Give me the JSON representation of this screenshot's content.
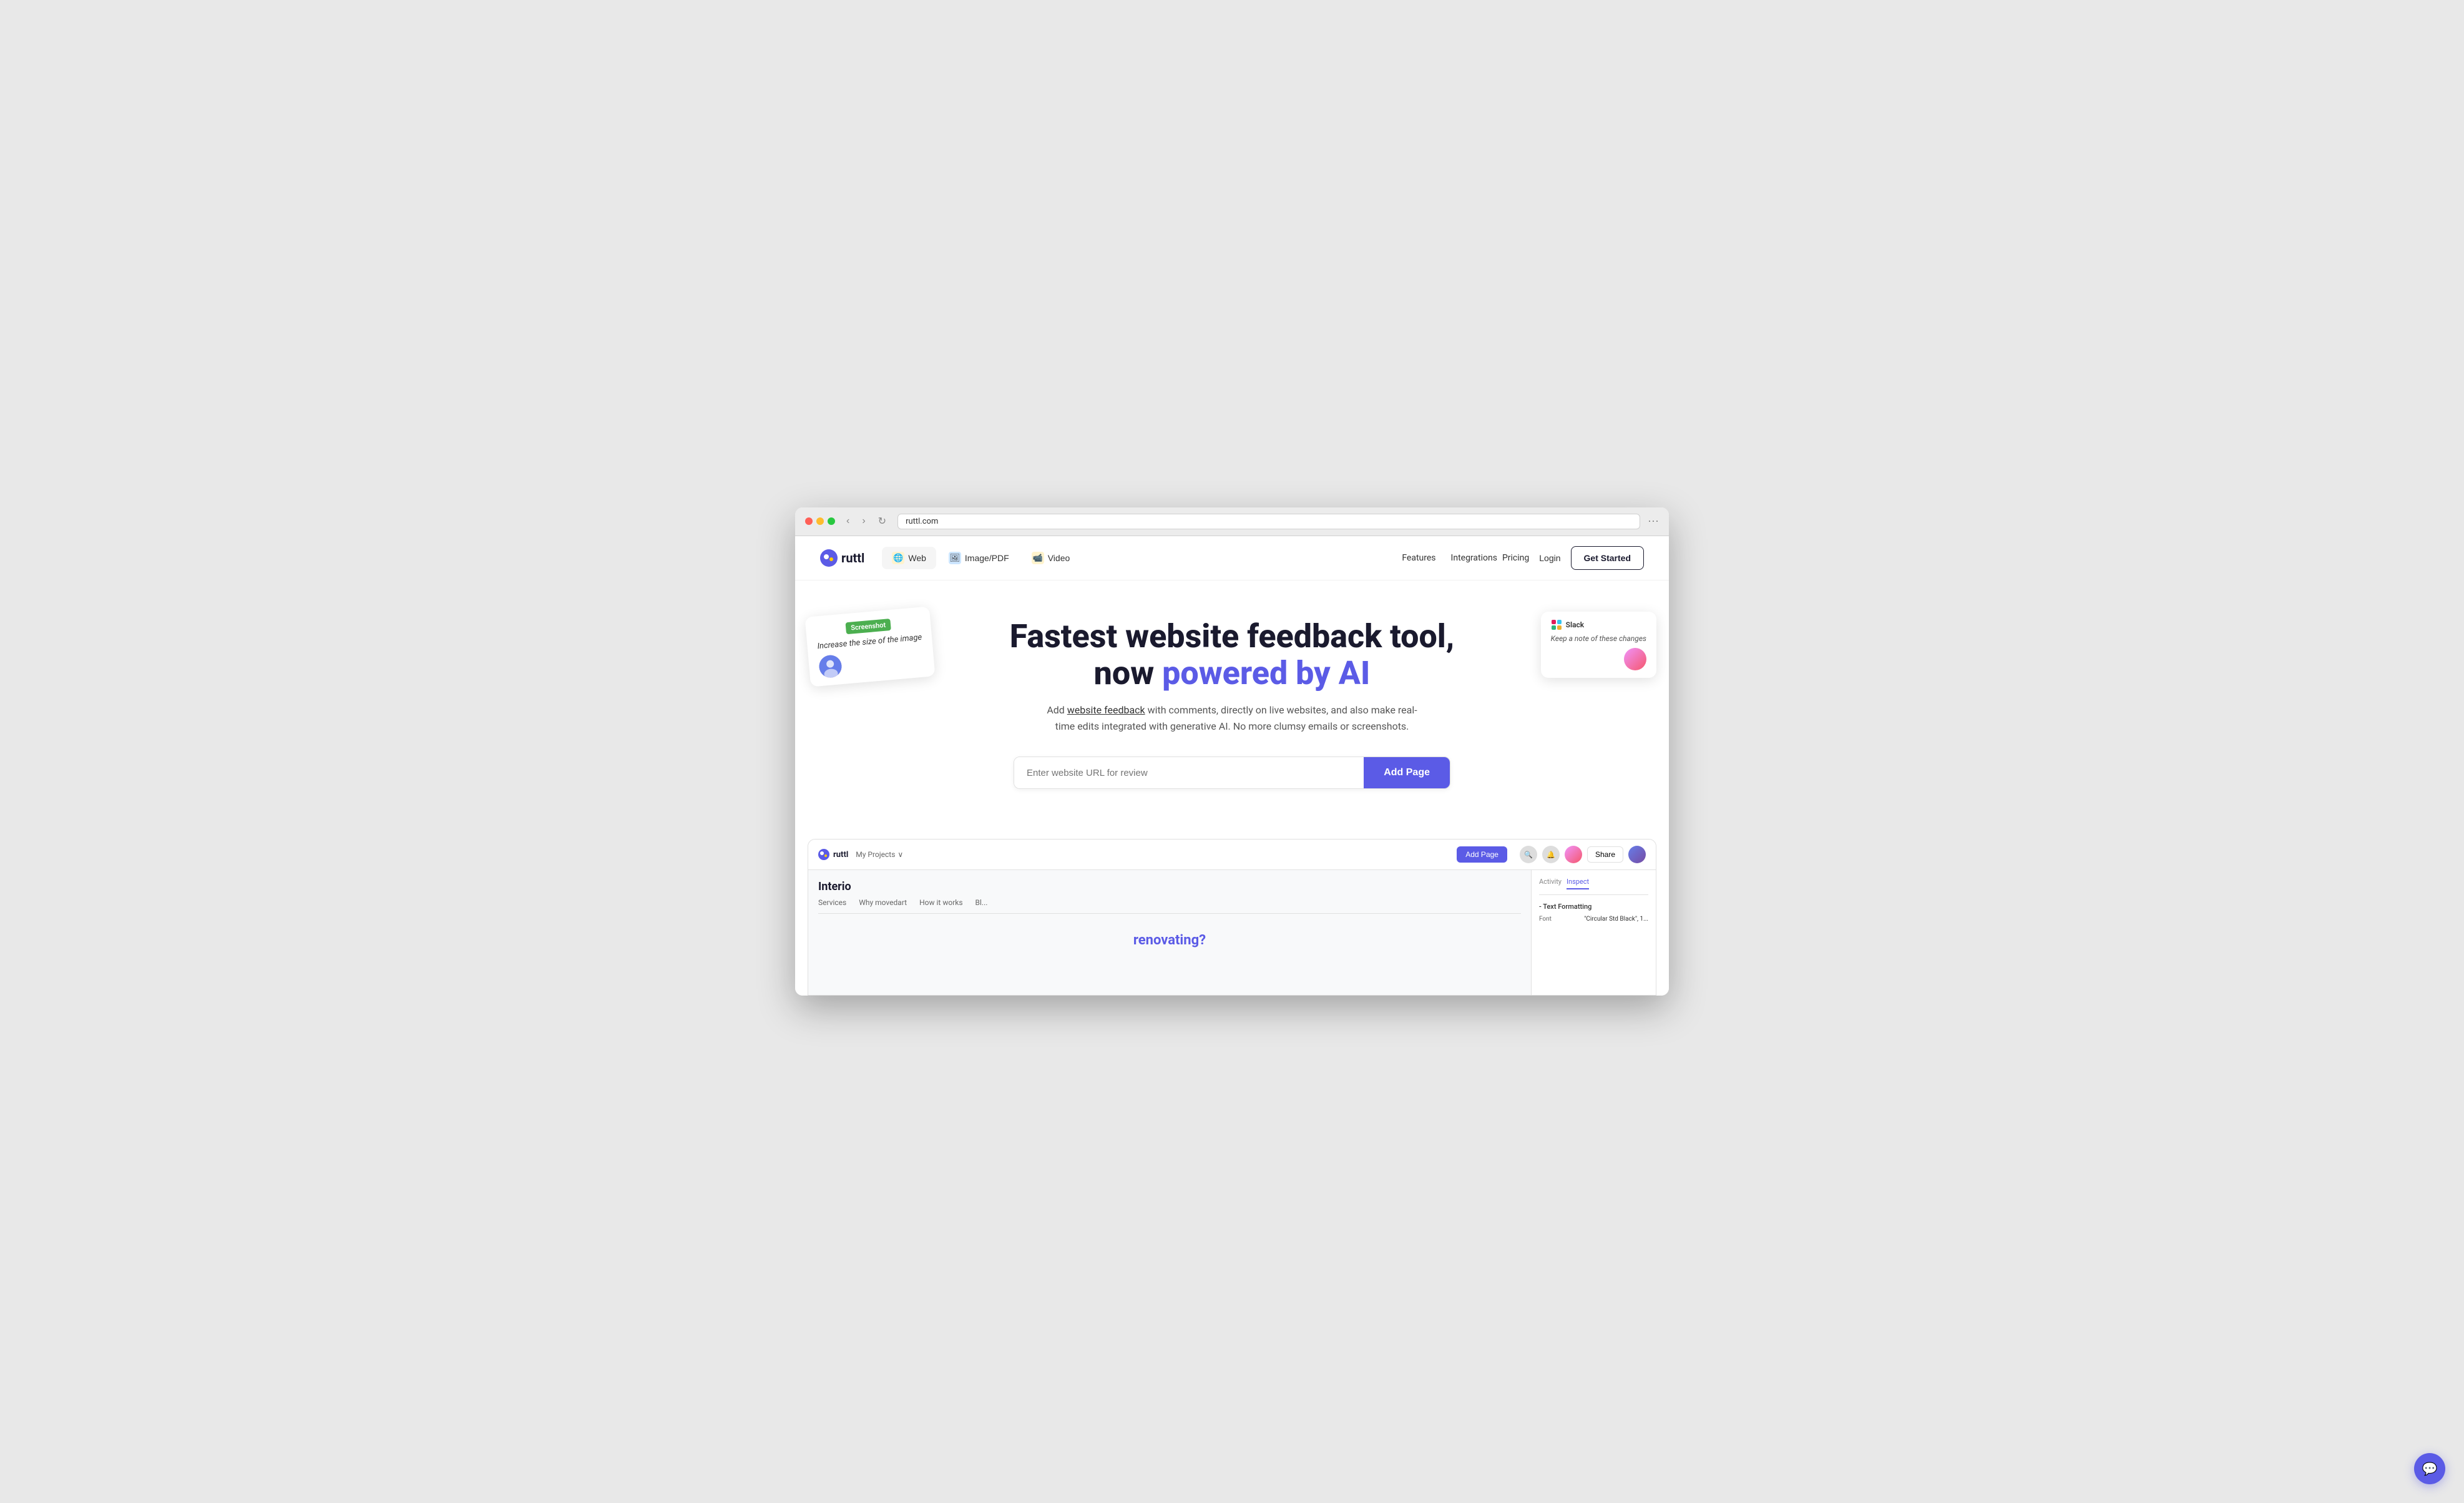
{
  "browser": {
    "address": "ruttl.com"
  },
  "nav": {
    "logo_text": "ruttl",
    "tabs": [
      {
        "id": "web",
        "label": "Web",
        "icon": "🌐"
      },
      {
        "id": "image",
        "label": "Image/PDF",
        "icon": "🖼️"
      },
      {
        "id": "video",
        "label": "Video",
        "icon": "📹"
      }
    ],
    "links": [
      "Features",
      "Integrations"
    ],
    "pricing": "Pricing",
    "login": "Login",
    "get_started": "Get Started"
  },
  "hero": {
    "heading_part1": "Fastest website feedback tool,",
    "heading_part2": "now ",
    "heading_accent": "powered by AI",
    "subtitle": "Add website feedback with comments, directly on live websites, and also make real-time edits integrated with generative AI. No more clumsy emails or screenshots.",
    "subtitle_link": "website feedback",
    "url_placeholder": "Enter website URL for review",
    "add_page_btn": "Add Page",
    "annotation_left": {
      "badge": "Screenshot",
      "text": "Increase the size of the image"
    },
    "annotation_right": {
      "platform": "Slack",
      "text": "Keep a note of these changes"
    }
  },
  "preview": {
    "logo": "ruttl",
    "breadcrumb": "My Projects",
    "add_page_btn": "Add Page",
    "share_btn": "Share",
    "page_title": "Interio",
    "page_nav": [
      "Services",
      "Why movedart",
      "How it works",
      "Bl..."
    ],
    "page_content": "renovating?",
    "sidebar_tabs": [
      "Activity",
      "Inspect"
    ],
    "active_tab": "Inspect",
    "text_formatting_header": "- Text Formatting",
    "font_label": "Font",
    "font_value": "\"Circular Std Black\", 1..."
  },
  "chat_btn": "💬",
  "colors": {
    "accent": "#5b5be6",
    "dark": "#1a1a2e",
    "green_badge": "#4CAF50"
  }
}
